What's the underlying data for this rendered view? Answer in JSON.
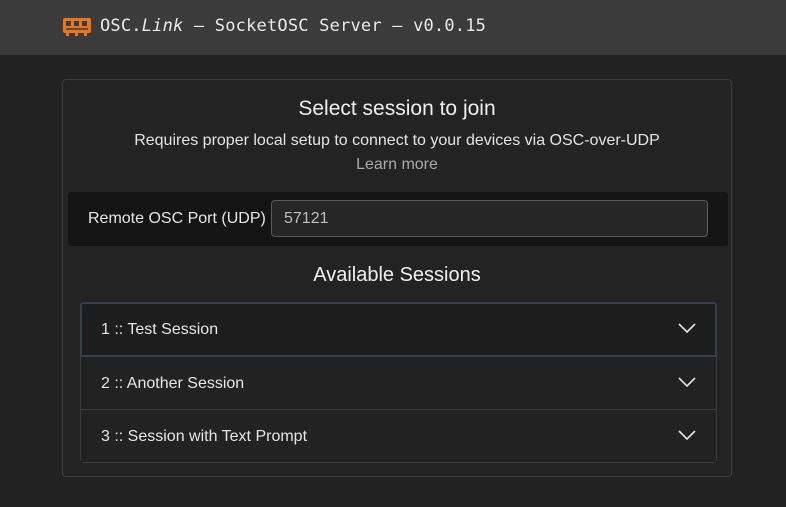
{
  "header": {
    "title_prefix": "OSC.",
    "title_italic": "Link",
    "title_suffix": " – SocketOSC Server – v0.0.15",
    "logo_icon": "osc-link-logo-icon"
  },
  "main": {
    "heading": "Select session to join",
    "subtext": "Requires proper local setup to connect to your devices via OSC-over-UDP",
    "learn_more": "Learn more",
    "port": {
      "label": "Remote OSC Port (UDP)",
      "value": "57121"
    },
    "sessions_heading": "Available Sessions",
    "sessions": [
      {
        "label": "1 :: Test Session"
      },
      {
        "label": "2 :: Another Session"
      },
      {
        "label": "3 :: Session with Text Prompt"
      }
    ]
  },
  "colors": {
    "background": "#222222",
    "header": "#3b3b3b",
    "logo": "#e8761f",
    "focus_border": "#33415a"
  }
}
